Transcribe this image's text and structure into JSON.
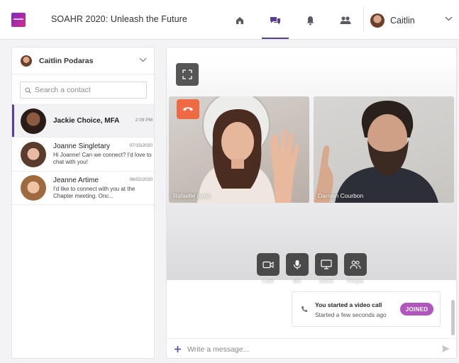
{
  "header": {
    "title": "SOAHR 2020: Unleash the Future",
    "nav": [
      {
        "name": "home-icon"
      },
      {
        "name": "chat-icon",
        "active": true
      },
      {
        "name": "bell-icon"
      },
      {
        "name": "people-icon"
      }
    ],
    "user_name": "Caitlin"
  },
  "sidebar": {
    "account_name": "Caitlin Podaras",
    "search_placeholder": "Search a contact",
    "contacts": [
      {
        "name": "Jackie Choice, MFA",
        "time": "2:09 PM",
        "preview": "",
        "active": true
      },
      {
        "name": "Joanne Singletary",
        "time": "07/15/2020",
        "preview": "Hi Joanne! Can we connect? I'd love to chat with you!",
        "active": false
      },
      {
        "name": "Jeanne Artime",
        "time": "06/02/2020",
        "preview": "I'd like to connect with you at the Chapter meeting. Onc...",
        "active": false
      }
    ]
  },
  "call": {
    "tiles": [
      {
        "label": "Rafaelle (you)"
      },
      {
        "label": "Damien Courbon"
      }
    ],
    "controls": [
      {
        "label": "Cam",
        "icon": "camera-icon"
      },
      {
        "label": "Mic",
        "icon": "microphone-icon"
      },
      {
        "label": "Share",
        "icon": "screen-share-icon"
      },
      {
        "label": "People",
        "icon": "participants-icon"
      }
    ]
  },
  "message": {
    "title": "You started a video call",
    "subtitle": "Started a few seconds ago",
    "badge": "JOINED"
  },
  "composer": {
    "placeholder": "Write a message..."
  },
  "colors": {
    "accent": "#5a3c9a",
    "hangup": "#ee6a43",
    "badge": "#b256bf"
  }
}
